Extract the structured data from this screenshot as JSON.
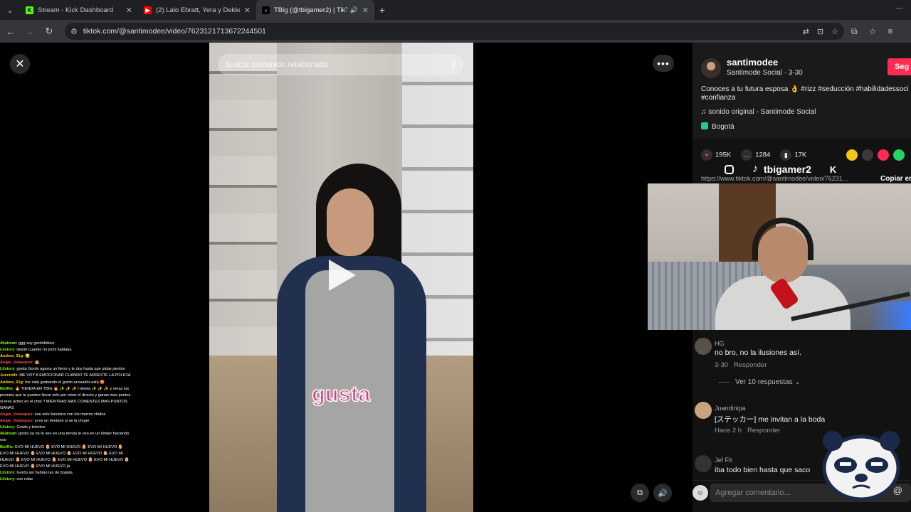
{
  "browser": {
    "tabs": [
      {
        "title": "Stream - Kick Dashboard",
        "favicon": "kick-icon",
        "active": false
      },
      {
        "title": "(2) Lalo Ebratt, Yera y Dekko - A",
        "favicon": "youtube-icon",
        "active": false
      },
      {
        "title": "TBig (@tbigamer2) | TikTok",
        "favicon": "tiktok-icon",
        "active": true
      }
    ],
    "new_tab": "+",
    "url": "tiktok.com/@santimodee/video/7623121713672244501"
  },
  "video": {
    "search_placeholder": "Buscar contenido relacionado",
    "caption": "gusta"
  },
  "post": {
    "username": "santimodee",
    "subtitle": "Santimode Social · 3-30",
    "follow_label": "Seg",
    "description": "Conoces a tu futura esposa 👌 #rizz #seducción #habilidadessoci #confianza",
    "sound": "sonido original - Santimode Social",
    "location": "Bogotá",
    "likes": "195K",
    "comments": "1284",
    "saves": "17K",
    "link": "https://www.tiktok.com/@santimodee/video/76231...",
    "copy_label": "Copiar en"
  },
  "brand_overlay": {
    "handle": "tbigamer2"
  },
  "comments": [
    {
      "name": "HG",
      "text": "no bro, no la ilusiones así.",
      "date": "3-30",
      "reply": "Responder"
    },
    {
      "name": "Juandinipa",
      "text": "[ステッカー] me invitan a la boda",
      "date": "Hace 2 h",
      "reply": "Responder"
    },
    {
      "name": "Jef Fit",
      "text": "iba todo bien hasta que saco",
      "date": "",
      "reply": ""
    }
  ],
  "view_replies": "Ver 10 respuestas",
  "composer_placeholder": "Agregar comentario...",
  "chat": [
    {
      "user": "4batman",
      "color": "#7cfc00",
      "msg": ": ggg soy gordofobico"
    },
    {
      "user": "Lilstory",
      "color": "#7cfc00",
      "msg": ": desde cuando mi pichi hablaba"
    },
    {
      "user": "Andres_01g",
      "color": "#ffd700",
      "msg": ": 🥲"
    },
    {
      "user": "Angie_Velasquez",
      "color": "#ff4d4d",
      "msg": ": 🤷"
    },
    {
      "user": "Lilstory",
      "color": "#7cfc00",
      "msg": ": gorda Gordo agarra un fierro y te doy hasta que pidas perdon"
    },
    {
      "user": "Joecrollz",
      "color": "#ffd700",
      "msg": ": ME VOY A EMOCIONAR CUANDO TE ARRESTE LA POLICIA"
    },
    {
      "user": "Andres_01g",
      "color": "#ffd700",
      "msg": ": me está grabando el gordo acosador está 😡"
    },
    {
      "user": "BotRix",
      "color": "#7cfc00",
      "msg": ": 🔥 TIENDA EN TBIG 🔥 ✨ ✨ ✨ l tienda ✨ ✨ ✨ y veras los premios que te puedes llevar solo por mirar el directo y ganas mas puntos si eres activo en el chat !! MIENTRAS MAS COMENTES MAS PUNTOS GANAS"
    },
    {
      "user": "Angie_Velasquez",
      "color": "#ff4d4d",
      "msg": ": eso solo funciona con los morros chidos"
    },
    {
      "user": "Angie_Velasquez",
      "color": "#ff4d4d",
      "msg": ": si es un beniano si se la chupe"
    },
    {
      "user": "Lilstory",
      "color": "#7cfc00",
      "msg": ": Gordo y treintoo"
    },
    {
      "user": "4batman",
      "color": "#7cfc00",
      "msg": ": gordo ya no te veo en una tienda te veo en un kinder haciendo eso"
    },
    {
      "user": "BotRix",
      "color": "#7cfc00",
      "msg": ": EVO MI HUEVO 🥚 EVO MI HUEVO 🥚 EVO MI HUEVO 🥚 EVO MI HUEVO 🥚 EVO MI HUEVO 🥚 EVO MI HUEVO 🥚 EVO MI HUEVO 🥚 EVO MI HUEVO 🥚 EVO MI HUEVO 🥚 EVO MI HUEVO 🥚 EVO MI HUEVO 🥚 EVO MI HUEVO [a"
    },
    {
      "user": "Lilstory",
      "color": "#7cfc00",
      "msg": ": Gordo así habían las de bogota"
    },
    {
      "user": "Lilstory",
      "color": "#7cfc00",
      "msg": ": con rolas"
    }
  ],
  "colors": {
    "accent": "#fe2c55",
    "caption": "#e23a84",
    "kick_green": "#53fc18"
  }
}
